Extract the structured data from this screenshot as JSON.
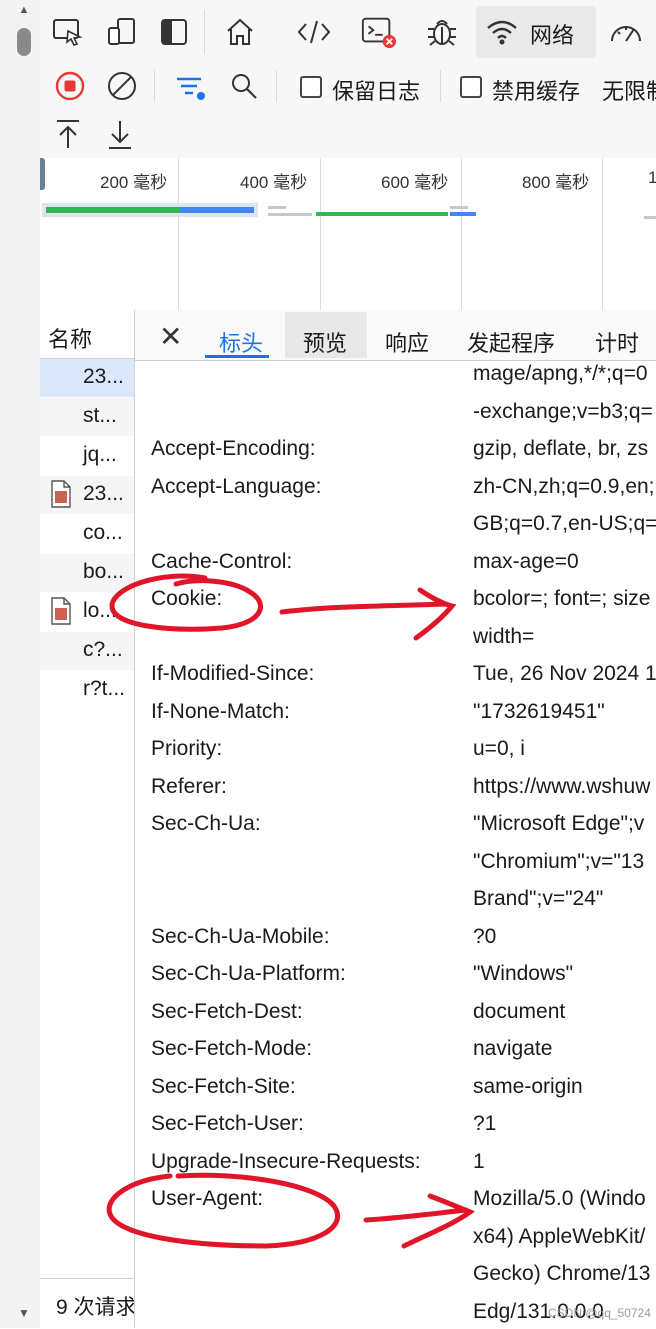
{
  "toolbar": {
    "icons": [
      "inspect-icon",
      "device-emulation-icon",
      "dock-icon",
      "welcome-home-icon",
      "elements-icon",
      "console-icon",
      "sources-icon",
      "network-icon",
      "performance-icon"
    ],
    "network_tab_label": "网络",
    "preserve_log_label": "保留日志",
    "disable_cache_label": "禁用缓存",
    "throttling_label": "无限制",
    "console_error_badge": "×",
    "record_color": "#e53935",
    "filter_color": "#1a73e8"
  },
  "overview": {
    "ticks": [
      "200 毫秒",
      "400 毫秒",
      "600 毫秒",
      "800 毫秒",
      "1"
    ]
  },
  "requests": {
    "header": "名称",
    "items": [
      {
        "name": "23...",
        "icon": "document",
        "selected": true
      },
      {
        "name": "st...",
        "icon": "none",
        "selected": false
      },
      {
        "name": "jq...",
        "icon": "none",
        "selected": false
      },
      {
        "name": "23...",
        "icon": "image-file",
        "selected": false
      },
      {
        "name": "co...",
        "icon": "none",
        "selected": false
      },
      {
        "name": "bo...",
        "icon": "none",
        "selected": false
      },
      {
        "name": "lo...",
        "icon": "image-file",
        "selected": false
      },
      {
        "name": "c?...",
        "icon": "none",
        "selected": false
      },
      {
        "name": "r?t...",
        "icon": "none",
        "selected": false
      }
    ],
    "footer": "9 次请求"
  },
  "details": {
    "close_label": "✕",
    "tabs": [
      "标头",
      "预览",
      "响应",
      "发起程序",
      "计时"
    ],
    "active_tab": "标头",
    "headers": [
      {
        "name": "",
        "value": "mage/apng,*/*;q=0"
      },
      {
        "name": "",
        "value": "-exchange;v=b3;q="
      },
      {
        "name": "Accept-Encoding:",
        "value": "gzip, deflate, br, zs"
      },
      {
        "name": "Accept-Language:",
        "value": "zh-CN,zh;q=0.9,en;"
      },
      {
        "name": "",
        "value": "GB;q=0.7,en-US;q="
      },
      {
        "name": "Cache-Control:",
        "value": "max-age=0"
      },
      {
        "name": "Cookie:",
        "value": "bcolor=; font=; size"
      },
      {
        "name": "",
        "value": "width="
      },
      {
        "name": "If-Modified-Since:",
        "value": "Tue, 26 Nov 2024 1"
      },
      {
        "name": "If-None-Match:",
        "value": "\"1732619451\""
      },
      {
        "name": "Priority:",
        "value": "u=0, i"
      },
      {
        "name": "Referer:",
        "value": "https://www.wshuw"
      },
      {
        "name": "Sec-Ch-Ua:",
        "value": "\"Microsoft Edge\";v"
      },
      {
        "name": "",
        "value": "\"Chromium\";v=\"13"
      },
      {
        "name": "",
        "value": "Brand\";v=\"24\""
      },
      {
        "name": "Sec-Ch-Ua-Mobile:",
        "value": "?0"
      },
      {
        "name": "Sec-Ch-Ua-Platform:",
        "value": "\"Windows\""
      },
      {
        "name": "Sec-Fetch-Dest:",
        "value": "document"
      },
      {
        "name": "Sec-Fetch-Mode:",
        "value": "navigate"
      },
      {
        "name": "Sec-Fetch-Site:",
        "value": "same-origin"
      },
      {
        "name": "Sec-Fetch-User:",
        "value": "?1"
      },
      {
        "name": "Upgrade-Insecure-Requests:",
        "value": "1"
      },
      {
        "name": "User-Agent:",
        "value": "Mozilla/5.0 (Windo"
      },
      {
        "name": "",
        "value": "x64) AppleWebKit/"
      },
      {
        "name": "",
        "value": "Gecko) Chrome/13"
      },
      {
        "name": "",
        "value": "Edg/131.0.0.0"
      }
    ]
  },
  "annotations": {
    "color": "#e0152a"
  },
  "watermark": "CSDN @qq_50724"
}
